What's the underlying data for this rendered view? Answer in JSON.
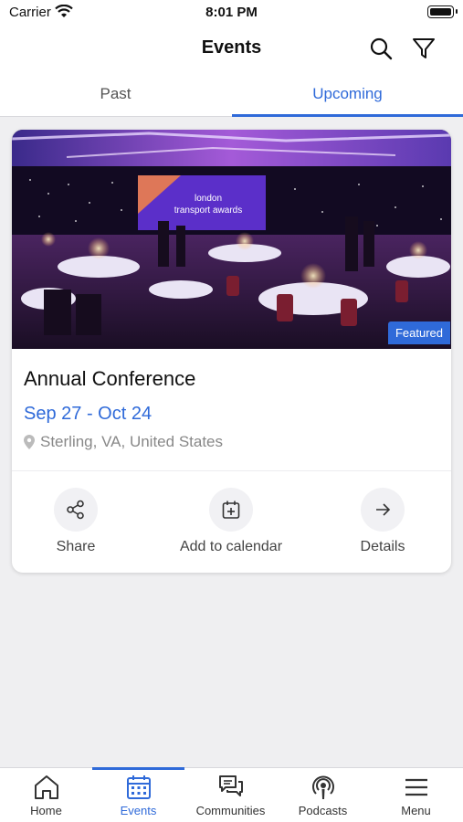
{
  "status_bar": {
    "carrier": "Carrier",
    "time": "8:01 PM"
  },
  "nav": {
    "title": "Events",
    "icons": [
      "search-icon",
      "filter-icon"
    ]
  },
  "tabs": [
    {
      "label": "Past",
      "active": false
    },
    {
      "label": "Upcoming",
      "active": true
    }
  ],
  "event": {
    "image_text": {
      "line1": "london",
      "line2": "transport awards"
    },
    "badge": "Featured",
    "title": "Annual Conference",
    "dates": "Sep 27 - Oct 24",
    "location": "Sterling, VA, United States",
    "actions": [
      {
        "label": "Share",
        "icon": "share-icon"
      },
      {
        "label": "Add to calendar",
        "icon": "calendar-add-icon"
      },
      {
        "label": "Details",
        "icon": "arrow-right-icon"
      }
    ]
  },
  "tab_bar": {
    "items": [
      {
        "label": "Home",
        "icon": "home-icon",
        "active": false
      },
      {
        "label": "Events",
        "icon": "calendar-icon",
        "active": true
      },
      {
        "label": "Communities",
        "icon": "chat-icon",
        "active": false
      },
      {
        "label": "Podcasts",
        "icon": "podcast-icon",
        "active": false
      },
      {
        "label": "Menu",
        "icon": "menu-icon",
        "active": false
      }
    ]
  },
  "colors": {
    "accent": "#2f6ad9",
    "background": "#efeff1"
  }
}
